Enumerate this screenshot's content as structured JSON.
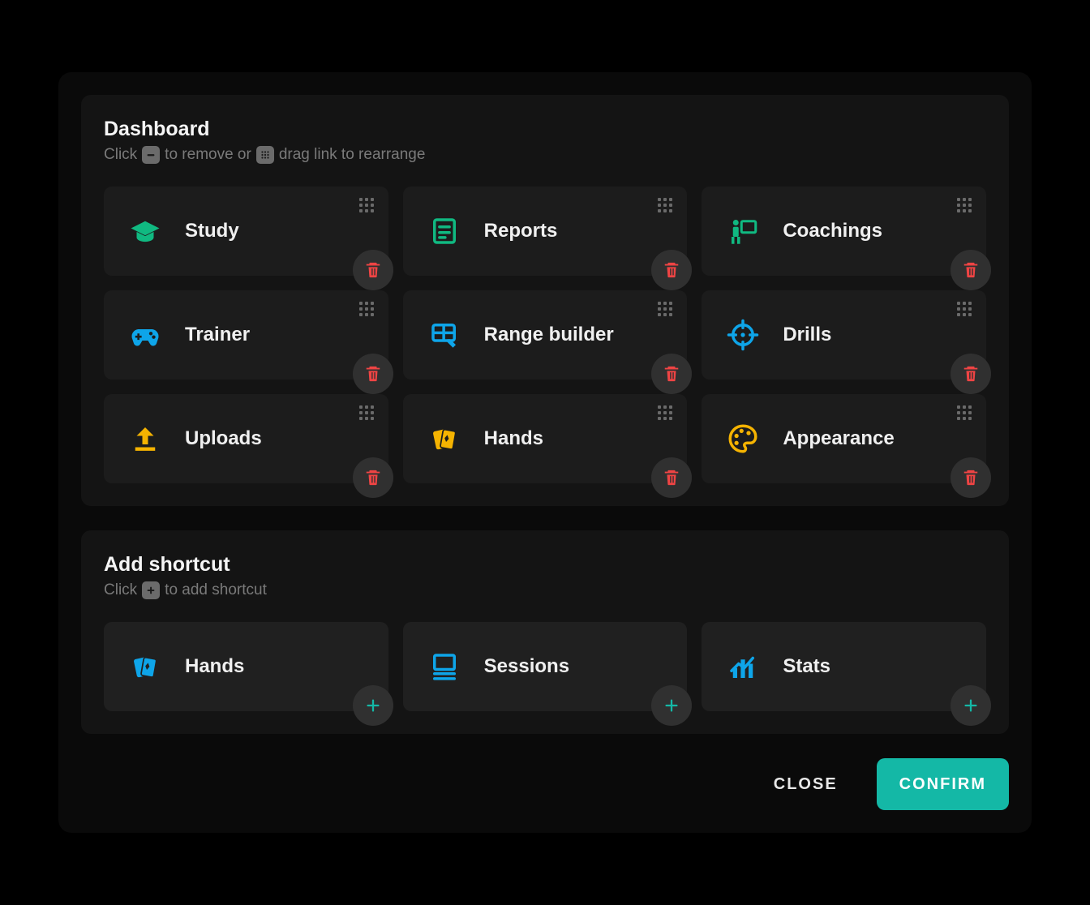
{
  "dashboard": {
    "title": "Dashboard",
    "hint_click": "Click",
    "hint_remove": "to remove or",
    "hint_drag": "drag link to rearrange",
    "items": [
      {
        "label": "Study",
        "icon": "graduation-cap-icon",
        "color": "#10b981"
      },
      {
        "label": "Reports",
        "icon": "document-icon",
        "color": "#10b981"
      },
      {
        "label": "Coachings",
        "icon": "presentation-icon",
        "color": "#10b981"
      },
      {
        "label": "Trainer",
        "icon": "gamepad-icon",
        "color": "#0ea5e9"
      },
      {
        "label": "Range builder",
        "icon": "table-edit-icon",
        "color": "#0ea5e9"
      },
      {
        "label": "Drills",
        "icon": "crosshair-icon",
        "color": "#0ea5e9"
      },
      {
        "label": "Uploads",
        "icon": "upload-icon",
        "color": "#f5b301"
      },
      {
        "label": "Hands",
        "icon": "cards-icon",
        "color": "#f5b301"
      },
      {
        "label": "Appearance",
        "icon": "palette-icon",
        "color": "#f5b301"
      }
    ]
  },
  "add_section": {
    "title": "Add shortcut",
    "hint_click": "Click",
    "hint_add": "to add shortcut",
    "items": [
      {
        "label": "Hands",
        "icon": "cards-icon",
        "color": "#0ea5e9"
      },
      {
        "label": "Sessions",
        "icon": "sessions-icon",
        "color": "#0ea5e9"
      },
      {
        "label": "Stats",
        "icon": "stats-icon",
        "color": "#0ea5e9"
      }
    ]
  },
  "footer": {
    "close": "CLOSE",
    "confirm": "CONFIRM"
  },
  "colors": {
    "delete": "#ef4444",
    "add": "#14b8a6"
  }
}
